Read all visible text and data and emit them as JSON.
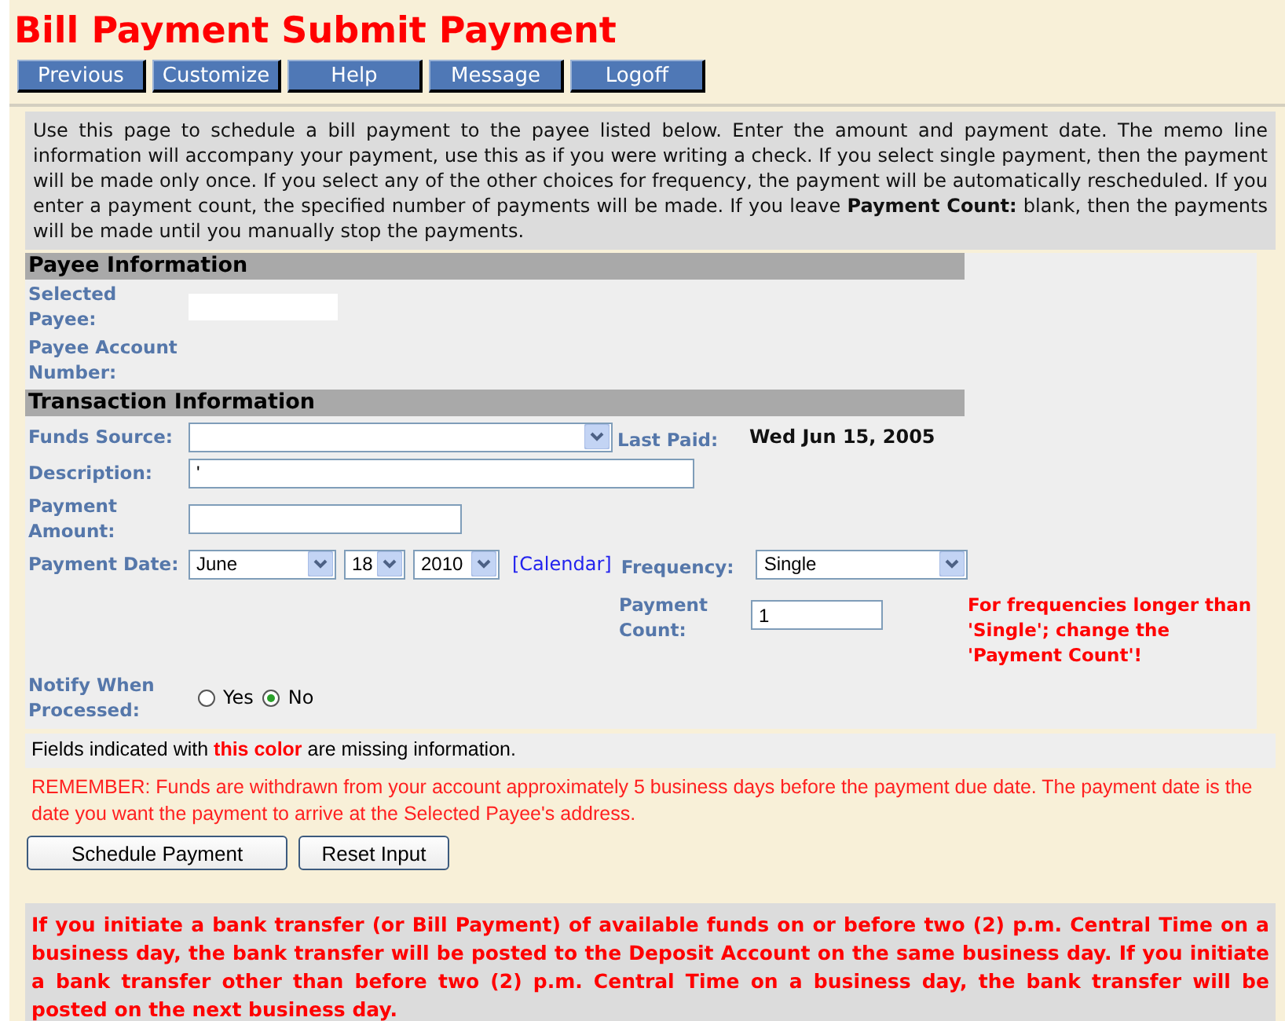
{
  "title": "Bill Payment Submit Payment",
  "nav_buttons": [
    "Previous",
    "Customize",
    "Help",
    "Message",
    "Logoff"
  ],
  "intro": "Use this page to schedule a bill payment to the payee listed below. Enter the amount and payment date. The memo line information will accompany your payment, use this as if you were writing a check. If you select single payment, then the payment will be made only once. If you select any of the other choices for frequency, the payment will be automatically rescheduled. If you enter a payment count, the specified number of payments will be made. If you leave **Payment Count:** blank, then the payments will be made until you manually stop the payments.",
  "payee_information": {
    "heading": "Payee Information",
    "selected_payee_label": "Selected Payee:",
    "account_number_label": "Payee Account Number:"
  },
  "transaction_information": {
    "heading": "Transaction Information",
    "funds_source": {
      "label": "Funds Source:"
    },
    "last_paid": {
      "label": "Last Paid:",
      "value": "Wed Jun 15, 2005"
    },
    "description": {
      "label": "Description:",
      "value": "'"
    },
    "payment_amount": {
      "label": "Payment Amount:"
    },
    "payment_date": {
      "label": "Payment Date:",
      "month": "June",
      "day": "18",
      "year": "2010",
      "calendar_link": "[Calendar]"
    },
    "frequency": {
      "label": "Frequency:",
      "value": "Single"
    },
    "payment_count": {
      "label": "Payment Count:",
      "value": "1",
      "note": "For frequencies longer than 'Single'; change the 'Payment Count'!"
    },
    "notify": {
      "label": "Notify When Processed:",
      "options": [
        {
          "label": "Yes",
          "selected": false
        },
        {
          "label": "No",
          "selected": true
        }
      ]
    }
  },
  "legend": "Fields indicated with **this color** are missing information.",
  "reminder": "REMEMBER: Funds are withdrawn from your account approximately 5 business days before the payment due date. The payment date is the date you want the payment to arrive at the Selected Payee's address.",
  "action_buttons": [
    "Schedule Payment",
    "Reset Input"
  ],
  "transfer_notice": "If you initiate a bank transfer (or Bill Payment) of available funds on or before two (2) p.m. Central Time on a business day, the bank transfer will be posted to the Deposit Account on the same business day. If you initiate a bank transfer other than before two (2) p.m. Central Time on a business day, the bank transfer will be posted on the next business day."
}
